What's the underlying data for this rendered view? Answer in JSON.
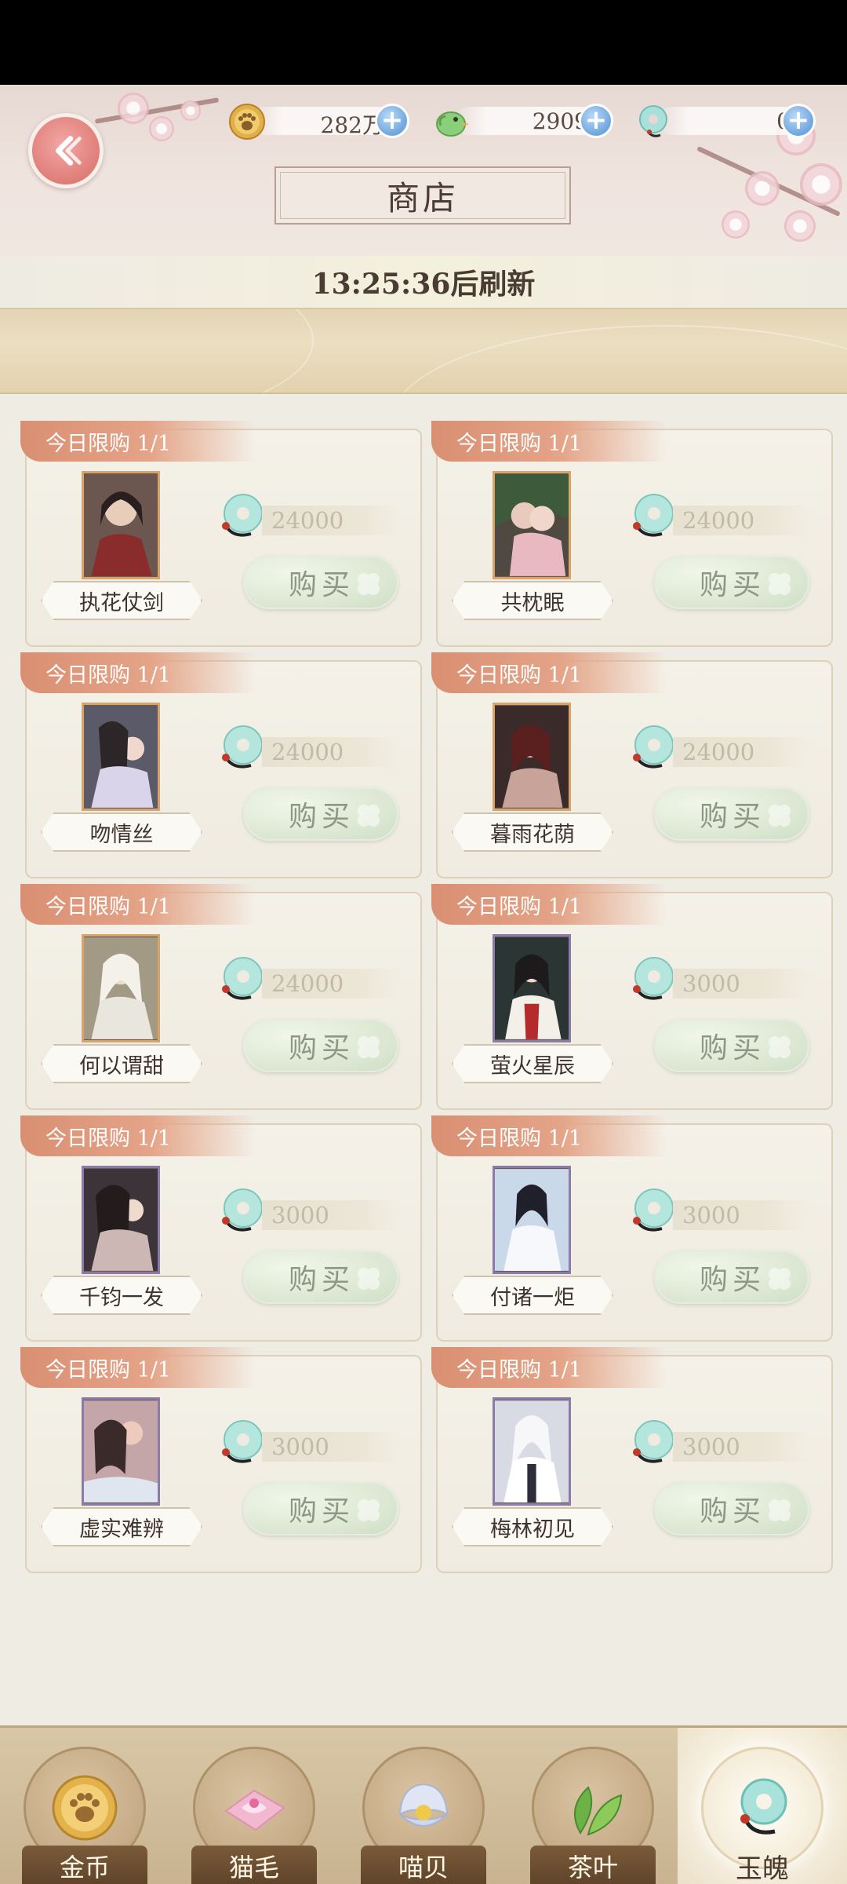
{
  "header": {
    "title": "商店",
    "currencies": [
      {
        "icon": "paw-coin-icon",
        "value": "282万"
      },
      {
        "icon": "green-bird-icon",
        "value": "2909"
      },
      {
        "icon": "jade-pendant-icon",
        "value": "0"
      }
    ]
  },
  "refresh_text": "13:25:36后刷新",
  "items": [
    {
      "limit": "今日限购 1/1",
      "name": "执花仗剑",
      "price": "24000",
      "buy": "购买"
    },
    {
      "limit": "今日限购 1/1",
      "name": "共枕眠",
      "price": "24000",
      "buy": "购买"
    },
    {
      "limit": "今日限购 1/1",
      "name": "吻情丝",
      "price": "24000",
      "buy": "购买"
    },
    {
      "limit": "今日限购 1/1",
      "name": "暮雨花荫",
      "price": "24000",
      "buy": "购买"
    },
    {
      "limit": "今日限购 1/1",
      "name": "何以谓甜",
      "price": "24000",
      "buy": "购买"
    },
    {
      "limit": "今日限购 1/1",
      "name": "萤火星辰",
      "price": "3000",
      "buy": "购买"
    },
    {
      "limit": "今日限购 1/1",
      "name": "千钧一发",
      "price": "3000",
      "buy": "购买"
    },
    {
      "limit": "今日限购 1/1",
      "name": "付诸一炬",
      "price": "3000",
      "buy": "购买"
    },
    {
      "limit": "今日限购 1/1",
      "name": "虚实难辨",
      "price": "3000",
      "buy": "购买"
    },
    {
      "limit": "今日限购 1/1",
      "name": "梅林初见",
      "price": "3000",
      "buy": "购买"
    }
  ],
  "bottom_nav": [
    {
      "label": "金币",
      "icon": "gold-paw-coin-icon"
    },
    {
      "label": "猫毛",
      "icon": "pink-fur-icon"
    },
    {
      "label": "喵贝",
      "icon": "pearl-shell-icon"
    },
    {
      "label": "茶叶",
      "icon": "tea-leaf-icon"
    },
    {
      "label": "玉魄",
      "icon": "jade-pendant-icon",
      "active": true
    }
  ],
  "colors": {
    "accent_tag": "#d98f72",
    "buy_button": "#dfead6",
    "back_button": "#df7e79",
    "nav_bg": "#d8c7a6"
  }
}
